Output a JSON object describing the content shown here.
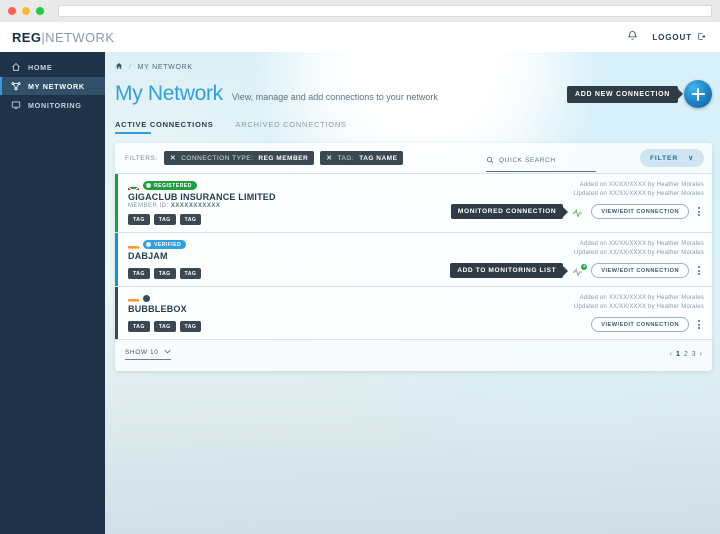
{
  "browser": {
    "traffic_lights": [
      "close",
      "minimize",
      "zoom"
    ],
    "url": ""
  },
  "topbar": {
    "brand_bold": "REG",
    "brand_divider": "|",
    "brand_light": "NETWORK",
    "notification_icon": "bell-icon",
    "logout_label": "LOGOUT",
    "logout_icon": "logout-arrow-icon"
  },
  "sidebar": {
    "items": [
      {
        "label": "HOME",
        "icon": "home-icon",
        "active": false
      },
      {
        "label": "MY NETWORK",
        "icon": "network-nodes-icon",
        "active": true
      },
      {
        "label": "MONITORING",
        "icon": "monitor-icon",
        "active": false
      }
    ]
  },
  "breadcrumb": {
    "home_icon": "home-icon",
    "separator": "/",
    "current": "MY NETWORK"
  },
  "header": {
    "title": "My Network",
    "subtitle": "View, manage and add connections to your network",
    "add_tooltip": "ADD NEW CONNECTION",
    "add_icon": "plus-icon"
  },
  "tabs": [
    {
      "label": "ACTIVE CONNECTIONS",
      "active": true
    },
    {
      "label": "ARCHIVED CONNECTIONS",
      "active": false
    }
  ],
  "filters": {
    "label": "FILTERS:",
    "chips": [
      {
        "remove_icon": "close-icon",
        "key": "CONNECTION TYPE:",
        "value": "REG MEMBER"
      },
      {
        "remove_icon": "close-icon",
        "key": "TAG:",
        "value": "TAG NAME"
      }
    ],
    "search": {
      "icon": "search-icon",
      "placeholder": "QUICK SEARCH",
      "value": ""
    },
    "filter_button": {
      "label": "FILTER",
      "chevron": "∨",
      "icon": "chevron-down-icon"
    }
  },
  "connections": [
    {
      "accent_color": "#1f9d3f",
      "flag": "flag-burundi",
      "status_badge": {
        "label": "REGISTERED",
        "color": "#1f9d3f",
        "style": "green"
      },
      "name": "GIGACLUB INSURANCE LIMITED",
      "member_id_label": "MEMBER ID:",
      "member_id_value": "XXXXXXXXXXX",
      "tags": [
        "TAG",
        "TAG",
        "TAG"
      ],
      "added": "Added on XX/XX/XXXX by Heather Morales",
      "updated": "Updated on XX/XX/XXXX by Heather Morales",
      "tooltip": "MONITORED CONNECTION",
      "monitor_icon": "pulse-icon",
      "monitor_badge": "",
      "view_edit_label": "VIEW/EDIT CONNECTION",
      "kebab_icon": "more-vertical-icon"
    },
    {
      "accent_color": "#1a8fd4",
      "flag": "flag-india",
      "status_badge": {
        "label": "VERIFIED",
        "color": "#2f9fe0",
        "style": "blue"
      },
      "name": "DABJAM",
      "member_id_label": "",
      "member_id_value": "",
      "tags": [
        "TAG",
        "TAG",
        "TAG"
      ],
      "added": "Added on XX/XX/XXXX by Heather Morales",
      "updated": "Updated on XX/XX/XXXX by Heather Morales",
      "tooltip": "ADD TO MONITORING LIST",
      "monitor_icon": "pulse-plus-icon",
      "monitor_badge": "+",
      "view_edit_label": "VIEW/EDIT CONNECTION",
      "kebab_icon": "more-vertical-icon"
    },
    {
      "accent_color": "#344a5e",
      "flag": "flag-india",
      "status_badge": null,
      "name": "BUBBLEBOX",
      "member_id_label": "",
      "member_id_value": "",
      "tags": [
        "TAG",
        "TAG",
        "TAG"
      ],
      "added": "Added on XX/XX/XXXX by Heather Morales",
      "updated": "Updated on XX/XX/XXXX by Heather Morales",
      "tooltip": "",
      "monitor_icon": "",
      "monitor_badge": "",
      "view_edit_label": "VIEW/EDIT CONNECTION",
      "kebab_icon": "more-vertical-icon"
    }
  ],
  "footer": {
    "show_label": "SHOW 10",
    "show_chevron_icon": "chevron-down-icon",
    "pager": {
      "prev": "‹",
      "pages": [
        "1",
        "2",
        "3"
      ],
      "current": "1",
      "next": "›"
    }
  }
}
